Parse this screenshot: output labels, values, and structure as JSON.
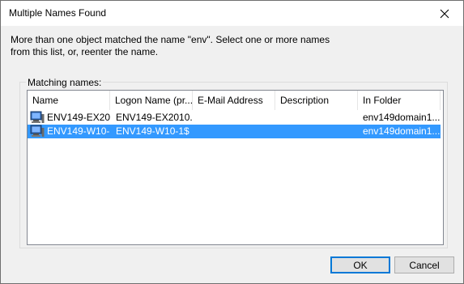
{
  "window": {
    "title": "Multiple Names Found"
  },
  "message": {
    "line1": "More than one object matched the name \"env\". Select one or more names",
    "line2": "from this list, or, reenter the name."
  },
  "matching_names_label": "Matching names:",
  "columns": [
    {
      "label": "Name"
    },
    {
      "label": "Logon Name (pr..."
    },
    {
      "label": "E-Mail Address"
    },
    {
      "label": "Description"
    },
    {
      "label": "In Folder"
    }
  ],
  "rows": [
    {
      "icon": "computer-icon",
      "name": "ENV149-EX20...",
      "logon": "ENV149-EX2010...",
      "email": "",
      "description": "",
      "folder": "env149domain1...",
      "selected": false
    },
    {
      "icon": "computer-icon",
      "name": "ENV149-W10-1",
      "logon": "ENV149-W10-1$",
      "email": "",
      "description": "",
      "folder": "env149domain1...",
      "selected": true
    }
  ],
  "buttons": {
    "ok": "OK",
    "cancel": "Cancel"
  },
  "colors": {
    "selection": "#3399ff",
    "default_button_border": "#0078d7"
  }
}
